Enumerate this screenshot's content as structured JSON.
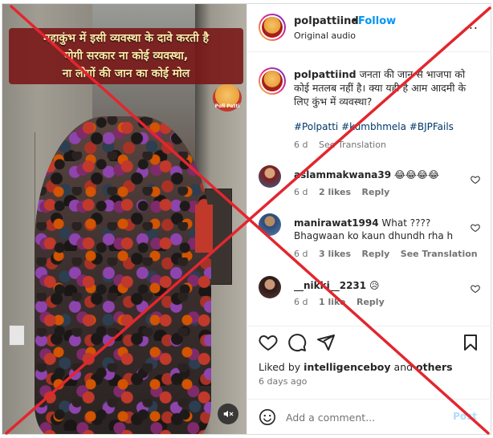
{
  "video": {
    "caption_lines": [
      "महाकुंभ में इसी व्यवस्था के दावे करती है",
      "योगी सरकार ना कोई व्यवस्था,",
      "ना लोगों की जान का कोई मोल"
    ],
    "logo_text": "Poll Patti",
    "mute_icon": "speaker-muted-icon"
  },
  "header": {
    "username": "polpattiind",
    "separator": "•",
    "follow_label": "Follow",
    "subtitle": "Original audio",
    "more_icon": "more-horizontal-icon",
    "more_text": "..."
  },
  "caption": {
    "username": "polpattiind",
    "text": "जनता की जान से भाजपा को कोई मतलब नहीं है। क्या यही है आम आदमी के लिए कुंभ में व्यवस्था?",
    "hashtags": "#Polpatti #kumbhmela #BJPFails",
    "age": "6 d",
    "see_translation": "See Translation"
  },
  "comments": [
    {
      "username": "aslammakwana39",
      "text": "😂😂😂😂",
      "age": "6 d",
      "likes": "2 likes",
      "reply": "Reply",
      "see_translation": ""
    },
    {
      "username": "manirawat1994",
      "text": "What ???? Bhagwaan ko kaun dhundh rha h",
      "age": "6 d",
      "likes": "3 likes",
      "reply": "Reply",
      "see_translation": "See Translation"
    },
    {
      "username": "__nikki__2231",
      "text": "😥",
      "age": "6 d",
      "likes": "1 like",
      "reply": "Reply",
      "see_translation": ""
    }
  ],
  "likes_line": {
    "prefix": "Liked by",
    "user": "intelligenceboy",
    "and": "and",
    "others": "others"
  },
  "post_age": "6 days ago",
  "add_comment": {
    "placeholder": "Add a comment...",
    "post_label": "Post"
  },
  "colors": {
    "accent": "#0095f6",
    "cross": "#e3262e",
    "caption_bg": "#781414",
    "caption_text": "#ffe9a8"
  }
}
